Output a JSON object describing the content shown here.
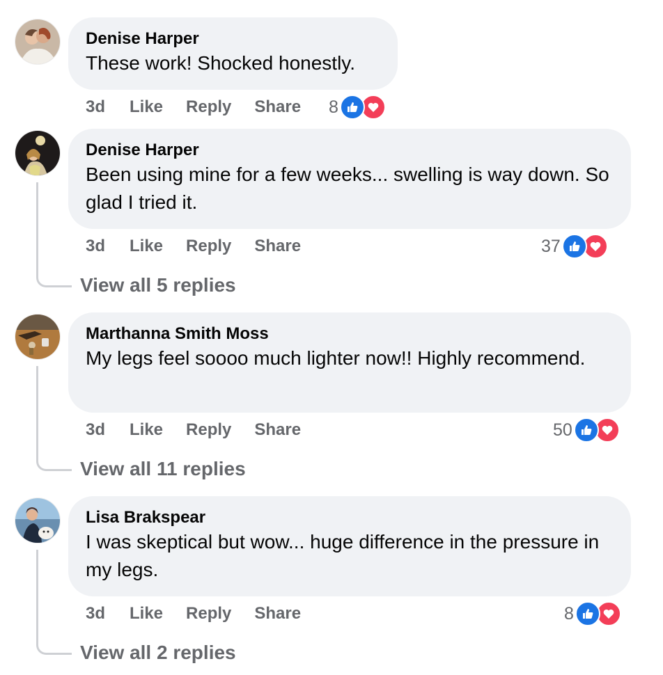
{
  "comments": [
    {
      "author": "Denise Harper",
      "text": "These work! Shocked honestly.",
      "time": "3d",
      "like_label": "Like",
      "reply_label": "Reply",
      "share_label": "Share",
      "reaction_count": "8"
    },
    {
      "author": "Denise Harper",
      "text": "Been using mine for a few weeks... swelling is way down. So glad I tried it.",
      "time": "3d",
      "like_label": "Like",
      "reply_label": "Reply",
      "share_label": "Share",
      "reaction_count": "37",
      "view_replies": "View all 5 replies"
    },
    {
      "author": "Marthanna Smith Moss",
      "text": "My legs feel soooo much lighter now!! Highly recommend.",
      "time": "3d",
      "like_label": "Like",
      "reply_label": "Reply",
      "share_label": "Share",
      "reaction_count": "50",
      "view_replies": "View all 11 replies"
    },
    {
      "author": "Lisa Brakspear",
      "text": "I was skeptical but wow... huge difference in the pressure in my legs.",
      "time": "3d",
      "like_label": "Like",
      "reply_label": "Reply",
      "share_label": "Share",
      "reaction_count": "8",
      "view_replies": "View all 2 replies"
    }
  ],
  "colors": {
    "bubble": "#f0f2f5",
    "secondary_text": "#65676b",
    "like_blue": "#1b74e4",
    "love_red": "#f33e58"
  },
  "icons": [
    "like-reaction-icon",
    "love-reaction-icon"
  ]
}
